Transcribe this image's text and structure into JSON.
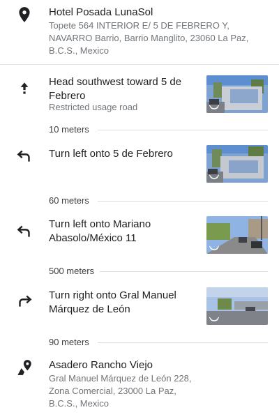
{
  "origin": {
    "name": "Hotel Posada LunaSol",
    "address": "Topete 564 INTERIOR E/ 5 DE FEBRERO Y, NAVARRO Barrio, Barrio Manglito, 23060 La Paz, B.C.S., Mexico",
    "icon": "location-pin-icon"
  },
  "steps": [
    {
      "instruction": "Head southwest toward 5 de Febrero",
      "note": "Restricted usage road",
      "icon": "arrow-up-icon",
      "distance": "10 meters"
    },
    {
      "instruction": "Turn left onto 5 de Febrero",
      "note": "",
      "icon": "turn-left-icon",
      "distance": "60 meters"
    },
    {
      "instruction": "Turn left onto Mariano Abasolo/México 11",
      "note": "",
      "icon": "turn-left-icon",
      "distance": "500 meters"
    },
    {
      "instruction": "Turn right onto Gral Manuel Márquez de León",
      "note": "",
      "icon": "turn-right-icon",
      "distance": "90 meters"
    }
  ],
  "destination": {
    "name": "Asadero Rancho Viejo",
    "address": "Gral Manuel Márquez de León 228, Zona Comercial, 23000 La Paz, B.C.S., Mexico",
    "icon": "destination-flag-icon"
  },
  "colors": {
    "text": "#202124",
    "secondary": "#70757a",
    "divider": "#dadce0"
  }
}
